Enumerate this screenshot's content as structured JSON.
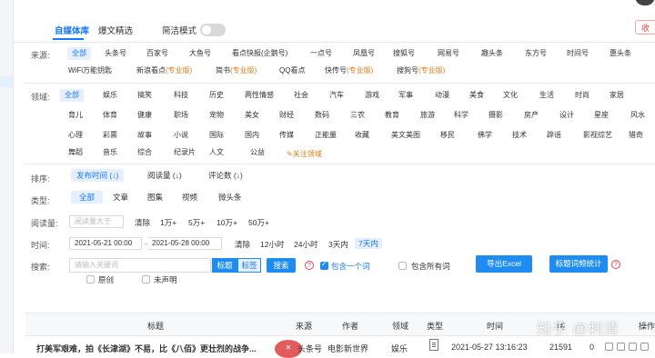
{
  "tabs": [
    {
      "label": "自媒体库",
      "active": true
    },
    {
      "label": "爆文精选",
      "active": false
    }
  ],
  "simple_mode": {
    "label": "简洁模式",
    "on": false
  },
  "collapse_label": "收",
  "source": {
    "label": "来源:",
    "items": [
      {
        "label": "全部",
        "active": true
      },
      {
        "label": "头条号"
      },
      {
        "label": "百家号"
      },
      {
        "label": "大鱼号"
      },
      {
        "label": "看点快报(企鹅号)"
      },
      {
        "label": "一点号"
      },
      {
        "label": "凤凰号"
      },
      {
        "label": "搜狐号"
      },
      {
        "label": "网易号"
      },
      {
        "label": "趣头条"
      },
      {
        "label": "东方号"
      },
      {
        "label": "时间号"
      },
      {
        "label": "惠头条"
      },
      {
        "label": "WiFi万能钥匙"
      },
      {
        "label": "新浪看点",
        "pro": "(专业版)"
      },
      {
        "label": "简书",
        "pro": "(专业版)"
      },
      {
        "label": "QQ看点"
      },
      {
        "label": "快传号",
        "pro": "(专业版)"
      },
      {
        "label": "搜狗号",
        "pro": "(专业版)"
      }
    ]
  },
  "domain": {
    "label": "领域:",
    "items": [
      "全部",
      "娱乐",
      "搞笑",
      "科技",
      "历史",
      "两性情感",
      "社会",
      "汽车",
      "游戏",
      "军事",
      "动漫",
      "美食",
      "文化",
      "生活",
      "时尚",
      "家居",
      "育儿",
      "体育",
      "健康",
      "职场",
      "宠物",
      "美女",
      "财经",
      "数码",
      "三农",
      "教育",
      "旅游",
      "科学",
      "摄影",
      "房产",
      "设计",
      "星座",
      "风水",
      "心理",
      "彩票",
      "故事",
      "小说",
      "国际",
      "国内",
      "传媒",
      "正能量",
      "收藏",
      "美文美图",
      "移民",
      "佛学",
      "技术",
      "辟谣",
      "影视综艺",
      "猎奇",
      "舞蹈",
      "音乐",
      "综合",
      "纪录片",
      "人文",
      "公益"
    ],
    "focus_label": "关注领域"
  },
  "sort": {
    "label": "排序:",
    "items": [
      {
        "label": "发布时间 (↓)",
        "active": true
      },
      {
        "label": "阅读量 (↓)"
      },
      {
        "label": "评论数 (↓)"
      }
    ]
  },
  "type": {
    "label": "类型:",
    "items": [
      {
        "label": "全部",
        "active": true
      },
      {
        "label": "文章"
      },
      {
        "label": "图集"
      },
      {
        "label": "视频"
      },
      {
        "label": "微头条"
      }
    ]
  },
  "reads": {
    "label": "阅读量:",
    "placeholder": "阅读量大于",
    "options": [
      "清除",
      "1万+",
      "5万+",
      "10万+",
      "50万+"
    ]
  },
  "time": {
    "label": "时间:",
    "start": "2021-05-21 00:00",
    "end": "2021-05-28 00:00",
    "options": [
      {
        "label": "清除"
      },
      {
        "label": "12小时"
      },
      {
        "label": "24小时"
      },
      {
        "label": "3天内"
      },
      {
        "label": "7天内",
        "active": true
      }
    ]
  },
  "search": {
    "label": "搜索:",
    "placeholder": "请输入关键词",
    "seg_title": "标题",
    "seg_tag": "标签",
    "button": "搜索",
    "help": "?",
    "include_one": "包含一个词",
    "include_all": "包含所有词",
    "export": "导出Excel",
    "stats": "标题词频统计",
    "original": "原创",
    "undeclared": "未声明"
  },
  "table": {
    "headers": [
      "标题",
      "来源",
      "作者",
      "领域",
      "类型",
      "时间",
      "阅读量",
      "操作"
    ],
    "header_partial": "阅",
    "rows": [
      {
        "title": "打美军艰难，拍《长津湖》不易，比《八佰》更壮烈的战争...",
        "source": "头条号",
        "author": "电影新世界",
        "domain": "娱乐",
        "time": "2021-05-27 13:16:23",
        "reads": "21591",
        "comments": "0"
      }
    ]
  },
  "watermark": "知乎 @刺清"
}
